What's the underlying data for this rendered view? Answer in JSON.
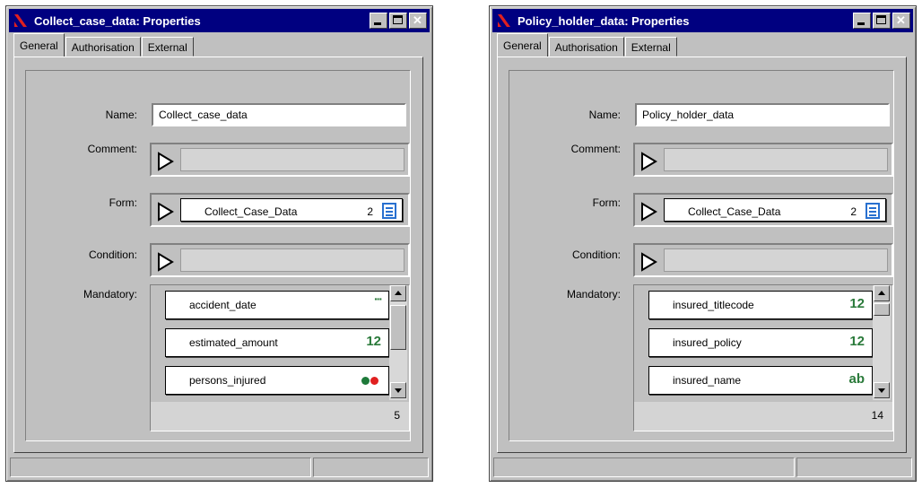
{
  "windows": [
    {
      "title": "Collect_case_data: Properties",
      "tabs": [
        "General",
        "Authorisation",
        "External"
      ],
      "labels": {
        "name": "Name:",
        "comment": "Comment:",
        "form": "Form:",
        "condition": "Condition:",
        "mandatory": "Mandatory:"
      },
      "name_value": "Collect_case_data",
      "form": {
        "name": "Collect_Case_Data",
        "number": "2",
        "icon": "form-icon"
      },
      "mandatory": {
        "items": [
          {
            "name": "accident_date",
            "type": "..."
          },
          {
            "name": "estimated_amount",
            "type": "12"
          },
          {
            "name": "persons_injured",
            "type": "dots"
          }
        ],
        "count": "5"
      },
      "accent_colors": {
        "title": "#000080",
        "type_text": "#2a7a3a",
        "dot_green": "#1e7a3a",
        "dot_red": "#e02020"
      }
    },
    {
      "title": "Policy_holder_data: Properties",
      "tabs": [
        "General",
        "Authorisation",
        "External"
      ],
      "labels": {
        "name": "Name:",
        "comment": "Comment:",
        "form": "Form:",
        "condition": "Condition:",
        "mandatory": "Mandatory:"
      },
      "name_value": "Policy_holder_data",
      "form": {
        "name": "Collect_Case_Data",
        "number": "2",
        "icon": "form-icon"
      },
      "mandatory": {
        "items": [
          {
            "name": "insured_titlecode",
            "type": "12"
          },
          {
            "name": "insured_policy",
            "type": "12"
          },
          {
            "name": "insured_name",
            "type": "ab"
          }
        ],
        "count": "14"
      },
      "accent_colors": {
        "title": "#000080",
        "type_text": "#2a7a3a",
        "dot_green": "#1e7a3a",
        "dot_red": "#e02020"
      }
    }
  ]
}
